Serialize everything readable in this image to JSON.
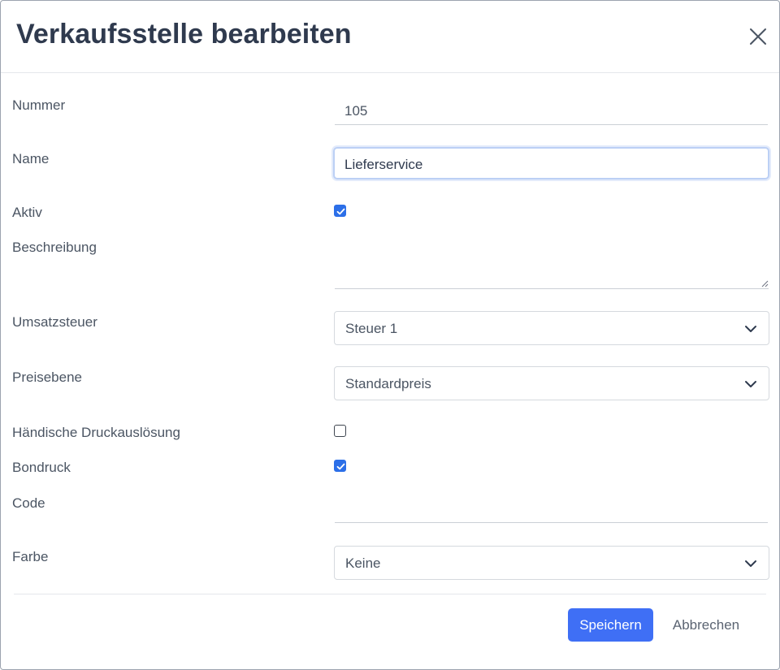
{
  "dialog": {
    "title": "Verkaufsstelle bearbeiten",
    "close_icon": "close-icon"
  },
  "form": {
    "nummer": {
      "label": "Nummer",
      "value": "105"
    },
    "name": {
      "label": "Name",
      "value": "Lieferservice"
    },
    "aktiv": {
      "label": "Aktiv",
      "checked": true
    },
    "beschreibung": {
      "label": "Beschreibung",
      "value": ""
    },
    "umsatzsteuer": {
      "label": "Umsatzsteuer",
      "selected": "Steuer 1"
    },
    "preisebene": {
      "label": "Preisebene",
      "selected": "Standardpreis"
    },
    "haendische_druckausloesung": {
      "label": "Händische Druckauslösung",
      "checked": false
    },
    "bondruck": {
      "label": "Bondruck",
      "checked": true
    },
    "code": {
      "label": "Code",
      "value": ""
    },
    "farbe": {
      "label": "Farbe",
      "selected": "Keine"
    }
  },
  "footer": {
    "save_label": "Speichern",
    "cancel_label": "Abbrechen"
  },
  "colors": {
    "primary": "#3f6ff5",
    "checkbox_checked": "#2c6fe8",
    "title": "#2f3a4e",
    "text": "#4b5563"
  }
}
